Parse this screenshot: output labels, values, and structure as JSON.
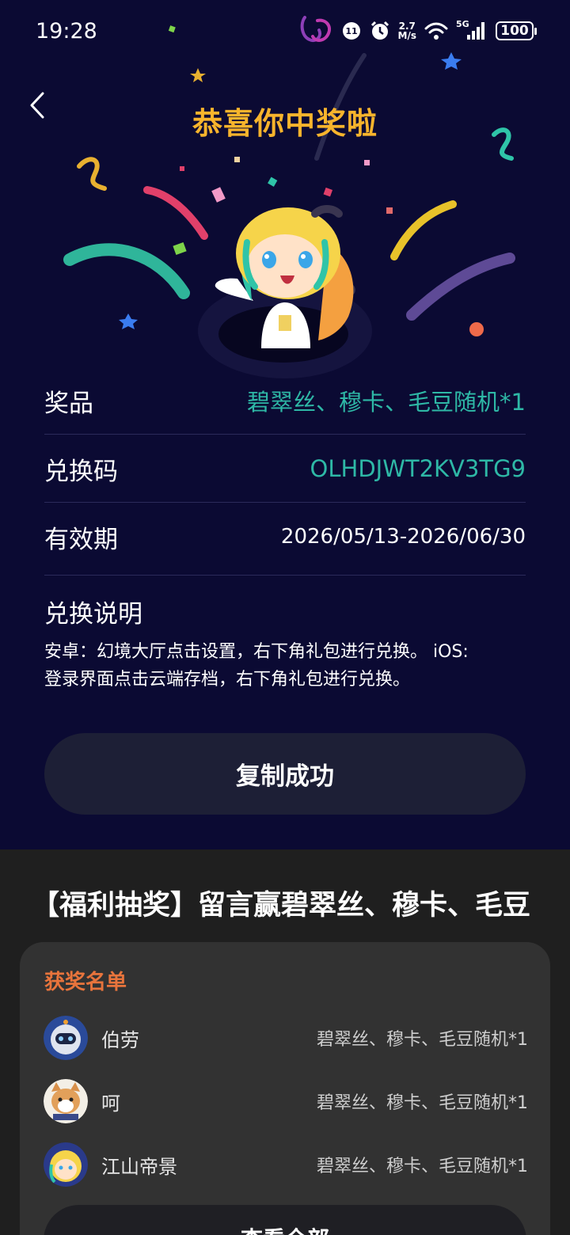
{
  "status_bar": {
    "time": "19:28",
    "net_speed_value": "2.7",
    "net_speed_unit": "M/s",
    "network": "5G",
    "battery": "100"
  },
  "header": {
    "title": "恭喜你中奖啦"
  },
  "prize_info": {
    "prize_label": "奖品",
    "prize_value": "碧翠丝、穆卡、毛豆随机*1",
    "code_label": "兑换码",
    "code_value": "OLHDJWT2KV3TG9",
    "validity_label": "有效期",
    "validity_value": "2026/05/13-2026/06/30",
    "instructions_title": "兑换说明",
    "instructions_line1": "安卓：幻境大厅点击设置，右下角礼包进行兑换。 iOS:",
    "instructions_line2": "登录界面点击云端存档，右下角礼包进行兑换。"
  },
  "copy_button": {
    "label": "复制成功"
  },
  "lottery": {
    "title": "【福利抽奖】留言赢碧翠丝、穆卡、毛豆",
    "winners_heading": "获奖名单",
    "winners": [
      {
        "name": "伯劳",
        "prize": "碧翠丝、穆卡、毛豆随机*1"
      },
      {
        "name": "呵",
        "prize": "碧翠丝、穆卡、毛豆随机*1"
      },
      {
        "name": "江山帝景",
        "prize": "碧翠丝、穆卡、毛豆随机*1"
      }
    ],
    "view_all_label": "查看全部"
  },
  "colors": {
    "background": "#0b0a33",
    "title_gold": "#f7b42c",
    "accent_teal": "#2eb8a6",
    "winners_orange": "#e8743c",
    "lower_bg": "#1f1f1f"
  },
  "icons": [
    "back-arrow-icon",
    "wifi-icon",
    "signal-icon",
    "alarm-icon",
    "battery-icon"
  ]
}
